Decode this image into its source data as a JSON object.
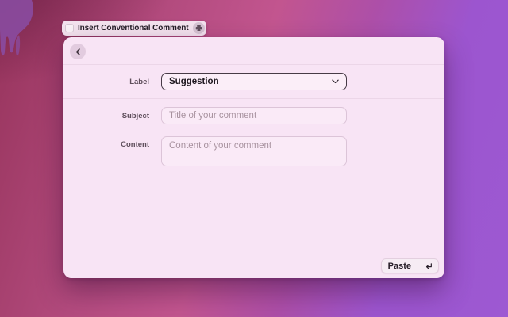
{
  "hud": {
    "title": "Insert Conventional Comment",
    "left_icon": "app-icon-ghost",
    "right_icon": "printer-icon"
  },
  "dialog": {
    "back_icon": "chevron-left-icon",
    "form": {
      "fields": [
        {
          "label": "Label",
          "type": "select",
          "value": "Suggestion"
        },
        {
          "label": "Subject",
          "type": "text",
          "placeholder": "Title of your comment"
        },
        {
          "label": "Content",
          "type": "textarea",
          "placeholder": "Content of your comment"
        }
      ]
    },
    "footer": {
      "primary_action": "Paste",
      "shortcut_icon": "return-icon"
    }
  },
  "colors": {
    "dialog_bg": "#f8e4f5",
    "select_border": "#473b46",
    "input_border": "#dcc4d8",
    "wallpaper_top_left": "#97345c",
    "wallpaper_pink": "#c2558f",
    "wallpaper_purple": "#9c55cf",
    "blob_purple": "#8a4b9f"
  }
}
